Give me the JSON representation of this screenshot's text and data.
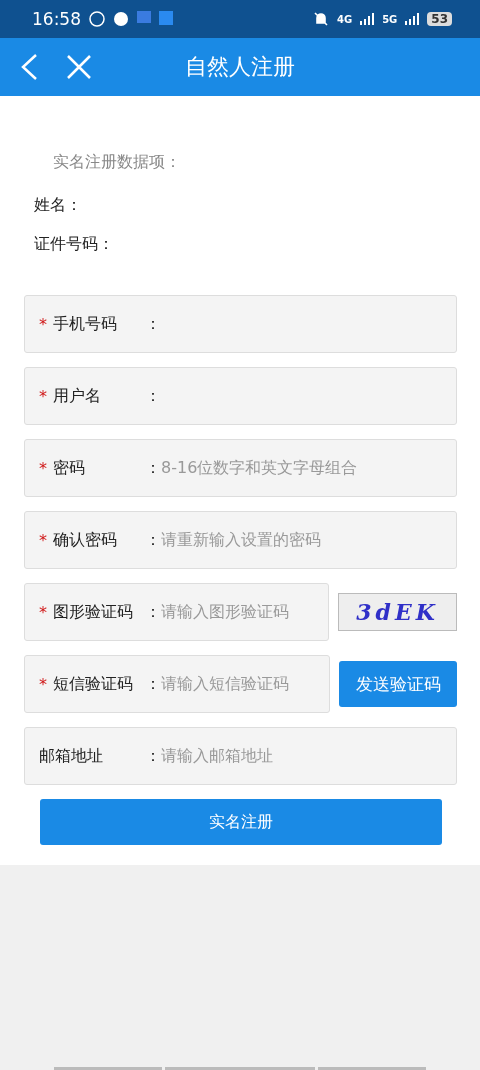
{
  "status_bar": {
    "time": "16:58",
    "net_4g": "4G",
    "net_5g": "5G",
    "battery": "53"
  },
  "header": {
    "title": "自然人注册"
  },
  "section_title": "实名注册数据项：",
  "info": [
    {
      "label": "姓名："
    },
    {
      "label": "证件号码："
    }
  ],
  "fields": [
    {
      "kind": "plain",
      "label": "手机号码",
      "required": true
    },
    {
      "kind": "plain",
      "label": "用户名",
      "required": true
    },
    {
      "kind": "plain",
      "label": "密码",
      "required": true,
      "placeholder": "8-16位数字和英文字母组合"
    },
    {
      "kind": "plain",
      "label": "确认密码",
      "required": true,
      "placeholder": "请重新输入设置的密码"
    },
    {
      "kind": "captcha",
      "label": "图形验证码",
      "required": true,
      "placeholder": "请输入图形验证码",
      "captcha": "3dEK"
    },
    {
      "kind": "sms",
      "label": "短信验证码",
      "required": true,
      "placeholder": "请输入短信验证码",
      "button": "发送验证码"
    },
    {
      "kind": "plain",
      "label": "邮箱地址",
      "required": false,
      "placeholder": "请输入邮箱地址"
    }
  ],
  "star": "*",
  "colon": "：",
  "submit": "实名注册"
}
